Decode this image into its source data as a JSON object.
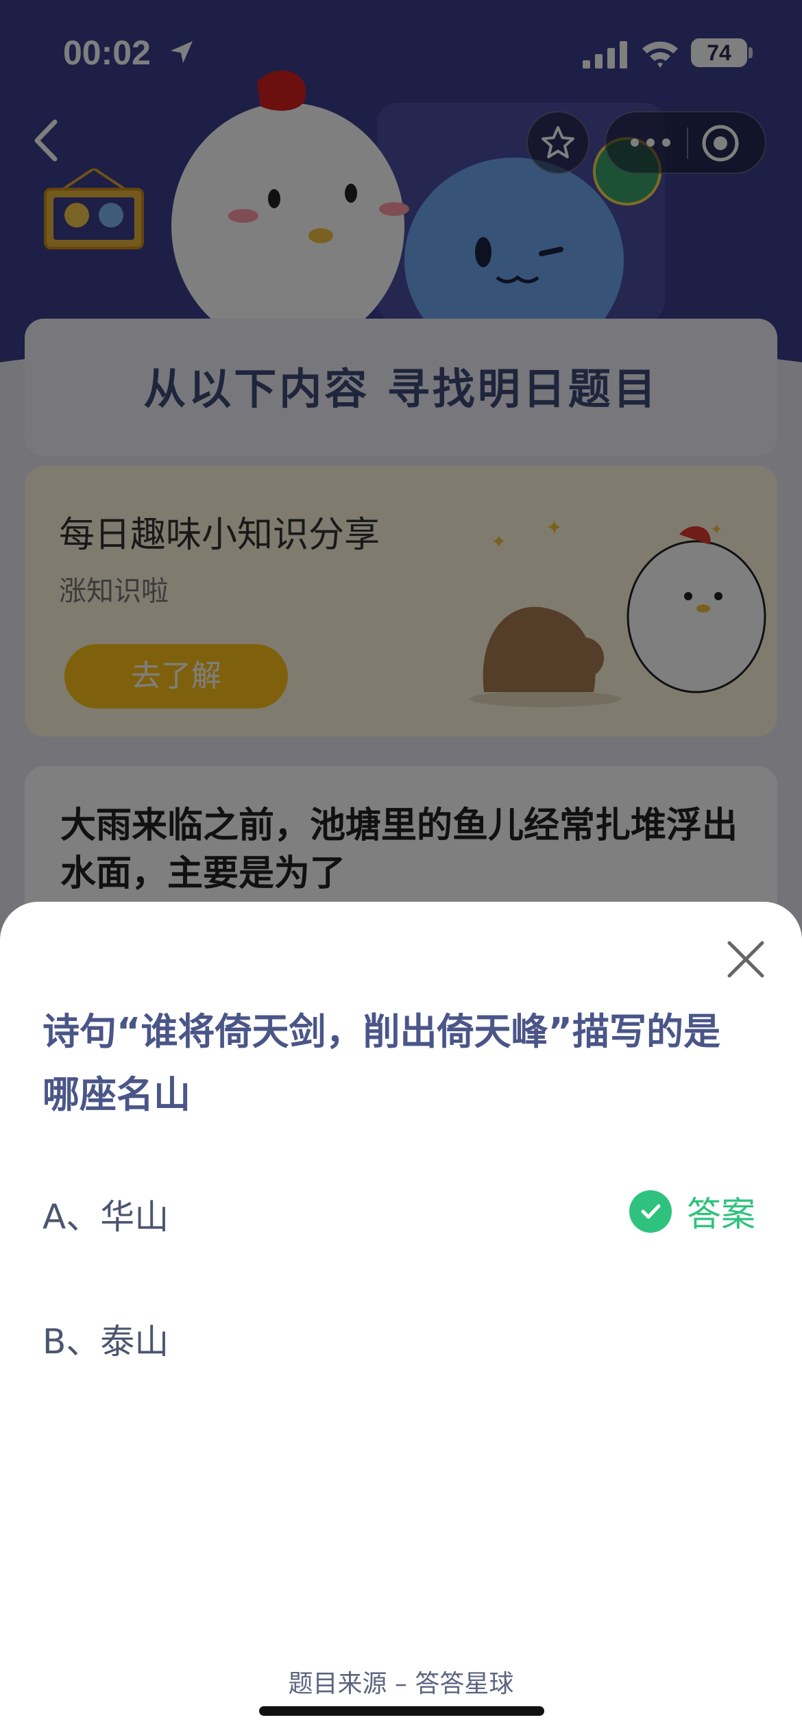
{
  "status_bar": {
    "time": "00:02",
    "battery": "74"
  },
  "background": {
    "banner_title": "从以下内容 寻找明日题目",
    "promo": {
      "title": "每日趣味小知识分享",
      "subtitle": "涨知识啦",
      "button": "去了解"
    },
    "question_card": {
      "text": "大雨来临之前，池塘里的鱼儿经常扎堆浮出水面，主要是为了"
    }
  },
  "sheet": {
    "question": "诗句“谁将倚天剑，削出倚天峰”描写的是哪座名山",
    "options": [
      {
        "label": "A、华山",
        "is_answer": true
      },
      {
        "label": "B、泰山",
        "is_answer": false
      }
    ],
    "answer_tag": "答案",
    "source": "题目来源 – 答答星球"
  },
  "colors": {
    "accent_green": "#2ec27e",
    "question_blue": "#4a5688",
    "promo_yellow": "#ffc21a"
  }
}
